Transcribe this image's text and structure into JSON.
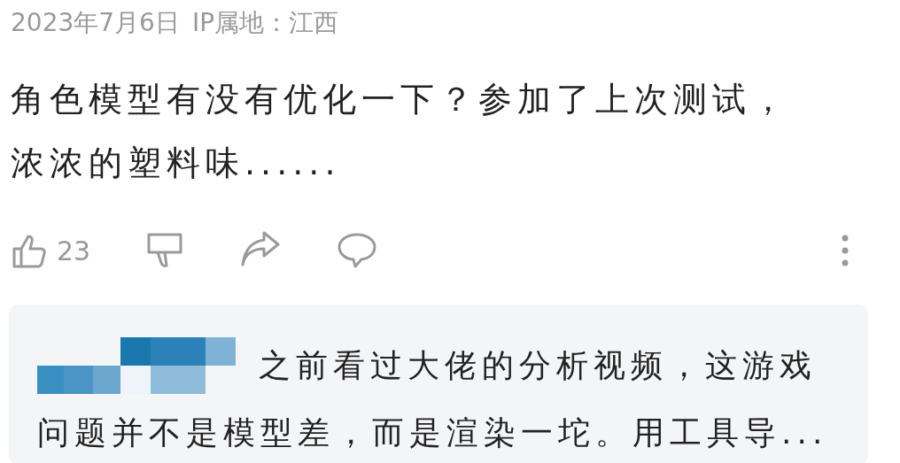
{
  "post": {
    "date": "2023年7月6日",
    "ip_location": "IP属地：江西",
    "text": "角色模型有没有优化一下？参加了上次测试，浓浓的塑料味......"
  },
  "actions": {
    "like_count": "23"
  },
  "reply": {
    "lines": [
      "之前看过大佬的分析视频，这游戏",
      "问题并不是模型差，而是渲染一坨。用工具导..."
    ]
  }
}
